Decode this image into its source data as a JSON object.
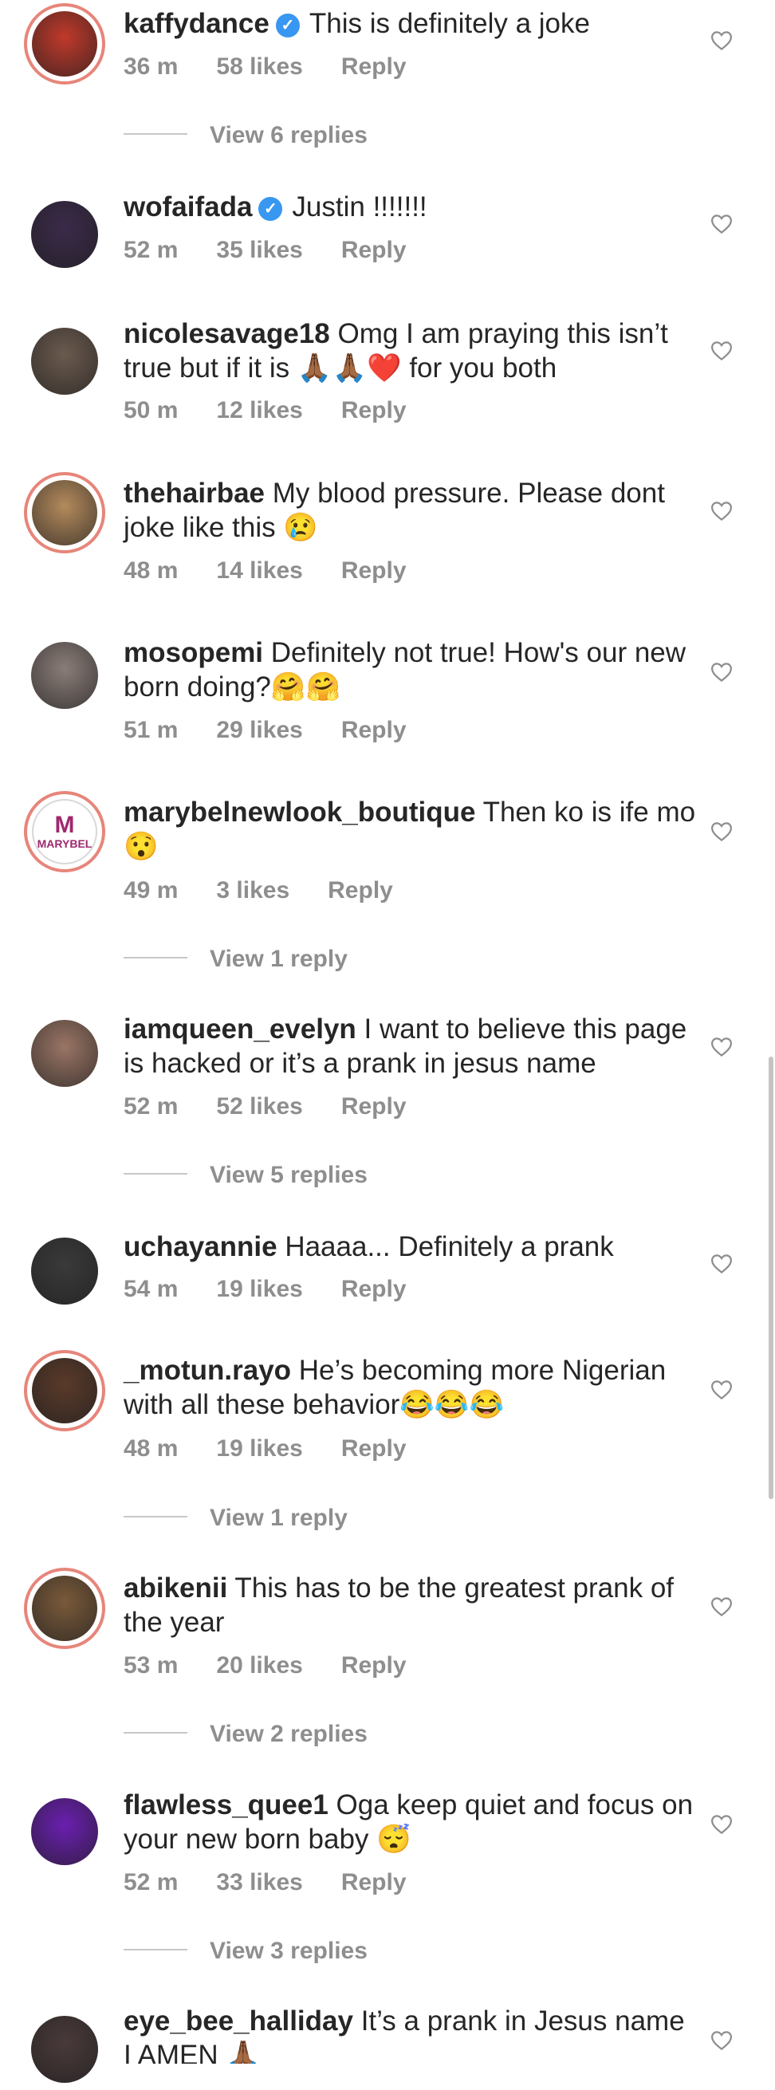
{
  "comments": [
    {
      "user": "kaffydance",
      "verified": true,
      "text": "This is definitely a joke",
      "time": "36 m",
      "likes": "58 likes",
      "reply": "Reply",
      "view_replies": "View 6 replies",
      "avatar_color": "#c0392b",
      "ring": true
    },
    {
      "user": "wofaifada",
      "verified": true,
      "text": "Justin !!!!!!!",
      "time": "52 m",
      "likes": "35 likes",
      "reply": "Reply",
      "view_replies": "",
      "avatar_color": "#3b2a4a",
      "ring": false
    },
    {
      "user": "nicolesavage18",
      "verified": false,
      "text": "Omg I am praying this isn’t true but if it is 🙏🏾🙏🏾❤️ for you both",
      "time": "50 m",
      "likes": "12 likes",
      "reply": "Reply",
      "view_replies": "",
      "avatar_color": "#6b5a4e",
      "ring": false
    },
    {
      "user": "thehairbae",
      "verified": false,
      "text": "My blood pressure. Please dont joke like this 😢",
      "time": "48 m",
      "likes": "14 likes",
      "reply": "Reply",
      "view_replies": "",
      "avatar_color": "#b48a5c",
      "ring": true
    },
    {
      "user": "mosopemi",
      "verified": false,
      "text": "Definitely not true! How's our new born doing?🤗🤗",
      "time": "51 m",
      "likes": "29 likes",
      "reply": "Reply",
      "view_replies": "",
      "avatar_color": "#8a7d78",
      "ring": false
    },
    {
      "user": "marybelnewlook_boutique",
      "verified": false,
      "text": "Then ko is ife mo 😯",
      "time": "49 m",
      "likes": "3 likes",
      "reply": "Reply",
      "view_replies": "View 1 reply",
      "avatar_color": "#a0286e",
      "ring": true,
      "avatar_text": "MARYBEL"
    },
    {
      "user": "iamqueen_evelyn",
      "verified": false,
      "text": "I want to believe this page is hacked or it’s a prank in jesus name",
      "time": "52 m",
      "likes": "52 likes",
      "reply": "Reply",
      "view_replies": "View 5 replies",
      "avatar_color": "#9a7565",
      "ring": false
    },
    {
      "user": "uchayannie",
      "verified": false,
      "text": "Haaaa... Definitely a prank",
      "time": "54 m",
      "likes": "19 likes",
      "reply": "Reply",
      "view_replies": "",
      "avatar_color": "#3a3a3a",
      "ring": false
    },
    {
      "user": "_motun.rayo",
      "verified": false,
      "text": "He’s becoming more Nigerian with all these behavior😂😂😂",
      "time": "48 m",
      "likes": "19 likes",
      "reply": "Reply",
      "view_replies": "View 1 reply",
      "avatar_color": "#5a3a2a",
      "ring": true
    },
    {
      "user": "abikenii",
      "verified": false,
      "text": "This has to be the greatest prank of the year",
      "time": "53 m",
      "likes": "20 likes",
      "reply": "Reply",
      "view_replies": "View 2 replies",
      "avatar_color": "#7a5a3a",
      "ring": true
    },
    {
      "user": "flawless_quee1",
      "verified": false,
      "text": "Oga  keep quiet and focus on your new born baby 😴",
      "time": "52 m",
      "likes": "33 likes",
      "reply": "Reply",
      "view_replies": "View 3 replies",
      "avatar_color": "#6a1fb0",
      "ring": false
    },
    {
      "user": "eye_bee_halliday",
      "verified": false,
      "text": "It’s a prank in Jesus name I AMEN 🙏🏾",
      "time": "",
      "likes": "",
      "reply": "",
      "view_replies": "",
      "avatar_color": "#4a3a3a",
      "ring": false
    }
  ]
}
